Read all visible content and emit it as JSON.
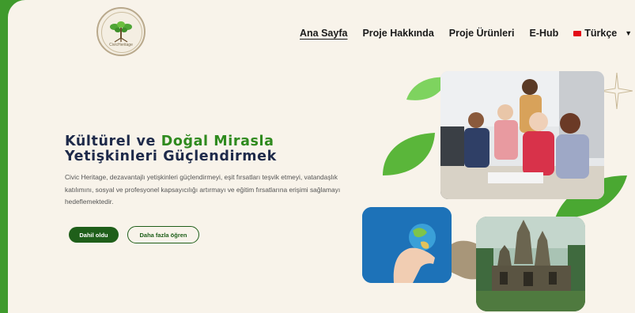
{
  "header": {
    "logo_text": "CivicHeritage",
    "nav": [
      {
        "label": "Ana Sayfa",
        "active": true
      },
      {
        "label": "Proje Hakkında",
        "active": false
      },
      {
        "label": "Proje Ürünleri",
        "active": false
      },
      {
        "label": "E-Hub",
        "active": false
      }
    ],
    "language": {
      "label": "Türkçe",
      "flag": "turkey-flag-icon"
    }
  },
  "hero": {
    "title_part1": "Kültürel ve ",
    "title_part2": "Doğal Mirasla",
    "title_line2": "Yetişkinleri Güçlendirmek",
    "description": "Civic Heritage, dezavantajlı yetişkinleri güçlendirmeyi, eşit fırsatları teşvik etmeyi, vatandaşlık katılımını, sosyal ve profesyonel kapsayıcılığı artırmayı ve eğitim fırsatlarına erişimi sağlamayı hedeflemektedir.",
    "primary_button": "Dahil oldu",
    "secondary_button": "Daha fazla öğren"
  },
  "colors": {
    "brand_green": "#3f9a2c",
    "dark_green": "#1f5f1a",
    "title_navy": "#1e2a4a",
    "background": "#f8f3ea"
  }
}
